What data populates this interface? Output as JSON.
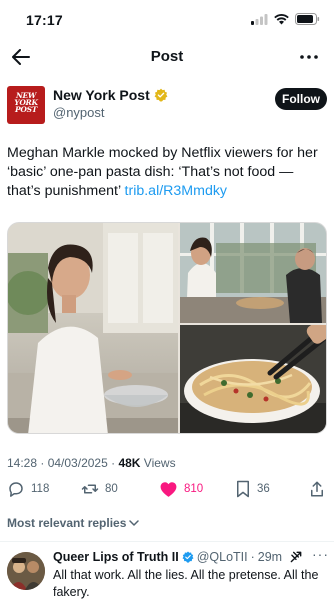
{
  "status_bar": {
    "time": "17:17"
  },
  "nav": {
    "title": "Post"
  },
  "author": {
    "name": "New York Post",
    "handle": "@nypost",
    "logo_lines": [
      "NEW",
      "YORK",
      "POST"
    ],
    "follow_label": "Follow",
    "verified_color": "#e2b719"
  },
  "tweet": {
    "text": "Meghan Markle mocked by Netflix viewers for her ‘basic’ one-pan pasta dish: ‘That’s not food — that’s punishment’",
    "link": "trib.al/R3Mmdky"
  },
  "meta": {
    "time": "14:28",
    "date": "04/03/2025",
    "views_count": "48K",
    "views_label": "Views"
  },
  "actions": {
    "replies": "118",
    "reposts": "80",
    "likes": "810",
    "bookmarks": "36"
  },
  "replies_header": {
    "label": "Most relevant replies"
  },
  "reply": {
    "name": "Queer Lips of Truth II",
    "handle": "@QLoTII",
    "age": "29m",
    "text": "All that work.  All the lies. All the pretense. All the fakery."
  },
  "colors": {
    "accent": "#1d9bf0",
    "like": "#f91880",
    "brand_red": "#b71c1c",
    "muted": "#536471"
  }
}
